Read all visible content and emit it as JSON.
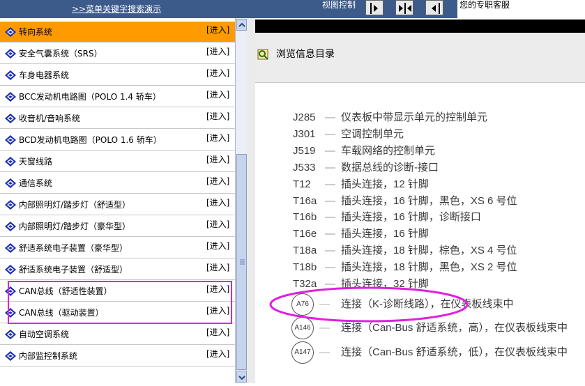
{
  "topbar": {
    "partial_left": "",
    "search_demo_link": ">>菜单关键字搜索演示",
    "partial_mid": "",
    "view_control_label": "视图控制",
    "service_text": "您的专职客服"
  },
  "left_list": {
    "items": [
      {
        "label": "转向系统",
        "action": "[进入]",
        "selected": true
      },
      {
        "label": "安全气囊系统（SRS）",
        "action": "[进入]"
      },
      {
        "label": "车身电器系统",
        "action": "[进入]"
      },
      {
        "label": "BCC发动机电路图（POLO 1.4 轿车）",
        "action": "[进入]"
      },
      {
        "label": "收音机/音响系统",
        "action": "[进入]"
      },
      {
        "label": "BCD发动机电路图（POLO 1.6 轿车）",
        "action": "[进入]"
      },
      {
        "label": "天窗线路",
        "action": "[进入]"
      },
      {
        "label": "通信系统",
        "action": "[进入]"
      },
      {
        "label": "内部照明灯/踏步灯（舒适型）",
        "action": "[进入]"
      },
      {
        "label": "内部照明灯/踏步灯（豪华型）",
        "action": "[进入]"
      },
      {
        "label": "舒适系统电子装置（豪华型）",
        "action": "[进入]"
      },
      {
        "label": "舒适系统电子装置（舒适型）",
        "action": "[进入]"
      },
      {
        "label": "CAN总线（舒适性装置）",
        "action": "[进入]"
      },
      {
        "label": "CAN总线（驱动装置）",
        "action": "[进入]"
      },
      {
        "label": "自动空调系统",
        "action": "[进入]"
      },
      {
        "label": "内部监控制系统",
        "action": "[进入]"
      }
    ]
  },
  "right_panel": {
    "browse_title": "浏览信息目录",
    "entries": [
      {
        "code": "J285",
        "dash": "—",
        "desc": "仪表板中带显示单元的控制单元"
      },
      {
        "code": "J301",
        "dash": "—",
        "desc": "空调控制单元"
      },
      {
        "code": "J519",
        "dash": "—",
        "desc": "车载网络的控制单元"
      },
      {
        "code": "J533",
        "dash": "—",
        "desc": "数据总线的诊断-接口"
      },
      {
        "code": "T12",
        "dash": "—",
        "desc": "插头连接，12 针脚"
      },
      {
        "code": "T16a",
        "dash": "—",
        "desc": "插头连接，16 针脚，黑色，XS 6 号位"
      },
      {
        "code": "T16b",
        "dash": "—",
        "desc": "插头连接，16 针脚，诊断接口"
      },
      {
        "code": "T16e",
        "dash": "—",
        "desc": "插头连接，16 针脚"
      },
      {
        "code": "T18a",
        "dash": "—",
        "desc": "插头连接，18 针脚，棕色，XS 4 号位"
      },
      {
        "code": "T18b",
        "dash": "—",
        "desc": "插头连接，18 针脚，黑色，XS 2 号位"
      },
      {
        "code": "T32a",
        "dash": "—",
        "desc": "插头连接，32 针脚"
      }
    ],
    "circled_entries": [
      {
        "code": "A76",
        "dash": "—",
        "desc": "连接（K-诊断线路），在仪表板线束中"
      },
      {
        "code": "A146",
        "dash": "—",
        "desc": "连接（Can-Bus 舒适系统，高），在仪表板线束中"
      },
      {
        "code": "A147",
        "dash": "—",
        "desc": "连接（Can-Bus 舒适系统，低），在仪表板线束中"
      }
    ]
  },
  "colors": {
    "selected_item": "#ff9a00",
    "highlight_box": "#e020e0",
    "ellipse": "#e020e0",
    "item_icon": "#1a2fb8"
  },
  "icons": {
    "list_item": "blue-diamond-book-icon",
    "browse": "magnifier-book-icon",
    "view_buttons": [
      "arrow-right-panel-icon",
      "split-panels-icon",
      "arrow-left-panel-icon"
    ]
  }
}
